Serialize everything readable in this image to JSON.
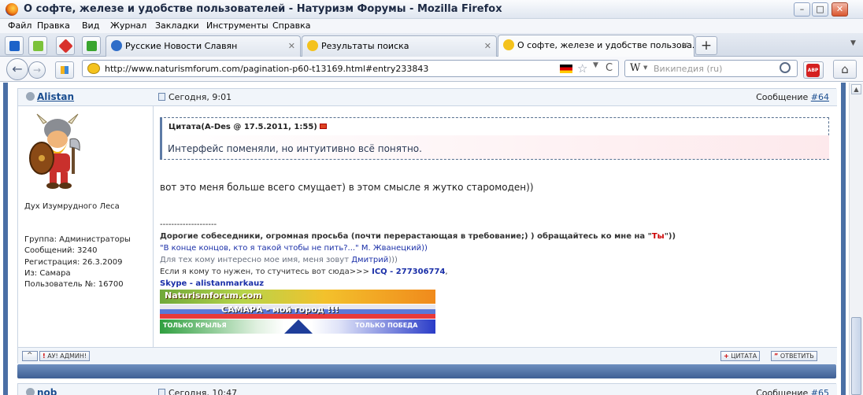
{
  "window": {
    "title": "О софте, железе и удобстве пользователей - Натуризм Форумы - Mozilla Firefox",
    "controls": {
      "minimize": "–",
      "maximize": "□",
      "close": "✕"
    }
  },
  "menu": [
    "Файл",
    "Правка",
    "Вид",
    "Журнал",
    "Закладки",
    "Инструменты",
    "Справка"
  ],
  "tabs": [
    {
      "label": "Русские Новости Славян",
      "active": false
    },
    {
      "label": "Результаты поиска",
      "active": false
    },
    {
      "label": "О софте, железе и удобстве пользова...",
      "active": true
    }
  ],
  "newtab_label": "+",
  "navbar": {
    "url": "http://www.naturismforum.com/pagination-p60-t13169.html#entry233843",
    "search_placeholder": "Википедия (ru)",
    "search_engine": "W",
    "reload": "C",
    "star": "☆",
    "abp": "ABP"
  },
  "post": {
    "username": "Alistan",
    "time": "Сегодня, 9:01",
    "message_label": "Сообщение",
    "message_num": "#64",
    "user_title": "Дух Изумрудного Леса",
    "user_info": [
      "Группа: Администраторы",
      "Сообщений: 3240",
      "Регистрация: 26.3.2009",
      "Из: Самара",
      "Пользователь №: 16700"
    ],
    "quote_header": "Цитата(A-Des @ 17.5.2011, 1:55)",
    "quote_text": "Интерфейс поменяли, но интуитивно всё понятно.",
    "body": "вот это меня больше всего смущает) в этом смысле я жутко старомоден))",
    "sig_separator": "--------------------",
    "sig_line1_pre": "Дорогие собеседники, огромная просьба (почти перерастающая в требование;) ) обращайтесь ко мне на \"",
    "sig_line1_ty": "Ты",
    "sig_line1_post": "\"))",
    "sig_line2": "\"В конце концов, кто я такой чтобы не пить?...\" М. Жванецкий))",
    "sig_line3_pre": "Для тех кому интересно мое имя, меня зовут ",
    "sig_line3_name": "Дмитрий",
    "sig_line3_post": ")))",
    "sig_line4_pre": "Если я кому то нужен, то стучитесь вот сюда>>> ",
    "sig_line4_icq": "ICQ - 277306774",
    "sig_line4_post": ",",
    "sig_line5": "Skype - alistanmarkauz",
    "banner1": "Naturismforum.com",
    "banner2": "САМАРА  -  мой город !!!",
    "banner3_left": "ТОЛЬКО КРЫЛЬЯ",
    "banner3_right": "ТОЛЬКО ПОБЕДА",
    "btn_up": "^",
    "btn_report": "АУ! АДМИН!",
    "btn_quote": "ЦИТАТА",
    "btn_reply": "ОТВЕТИТЬ"
  },
  "next_post": {
    "username": "nob",
    "time": "Сегодня, 10:47",
    "message_label": "Сообщение",
    "message_num": "#65"
  },
  "colors": {
    "link": "#1a4d8f",
    "rail": "#4a6fa5",
    "header_bg": "#f1f5fa",
    "sig_red": "#cc0000",
    "sig_blue": "#1a2fa8"
  }
}
